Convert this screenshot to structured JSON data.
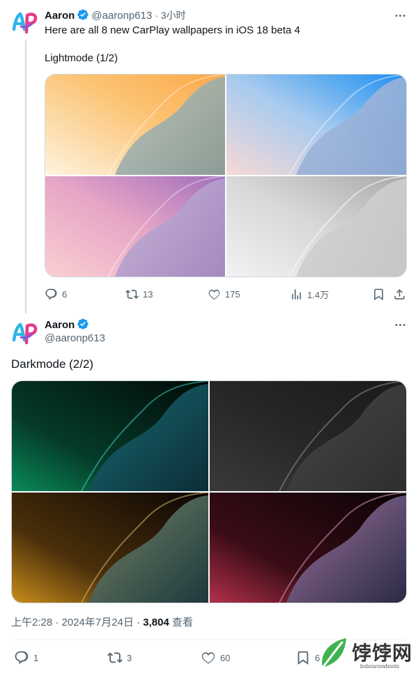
{
  "tweet1": {
    "author_name": "Aaron",
    "handle": "@aaronp613",
    "time": "· 3小时",
    "text": "Here are all 8 new CarPlay wallpapers in iOS 18 beta 4",
    "subtext": "Lightmode (1/2)",
    "actions": {
      "replies": "6",
      "retweets": "13",
      "likes": "175",
      "views": "1.4万"
    },
    "images": [
      "wallpaper-light-orange",
      "wallpaper-light-blue",
      "wallpaper-light-purple",
      "wallpaper-light-gray"
    ]
  },
  "tweet2": {
    "author_name": "Aaron",
    "handle": "@aaronp613",
    "text": "Darkmode (2/2)",
    "images": [
      "wallpaper-dark-green",
      "wallpaper-dark-gray",
      "wallpaper-dark-gold",
      "wallpaper-dark-pink"
    ],
    "timestamp": "上午2:28 · 2024年7月24日 · ",
    "views_count": "3,804",
    "views_label": " 查看",
    "actions": {
      "replies": "1",
      "retweets": "3",
      "likes": "60",
      "bookmarks": "6"
    }
  },
  "avatar_text": "AP",
  "watermark": {
    "title": "饽饽网",
    "subtitle": "bobosnowboots"
  },
  "colors": {
    "verified": "#1d9bf0",
    "text": "#0f1419",
    "secondary": "#536471",
    "border": "#cfd9de"
  }
}
